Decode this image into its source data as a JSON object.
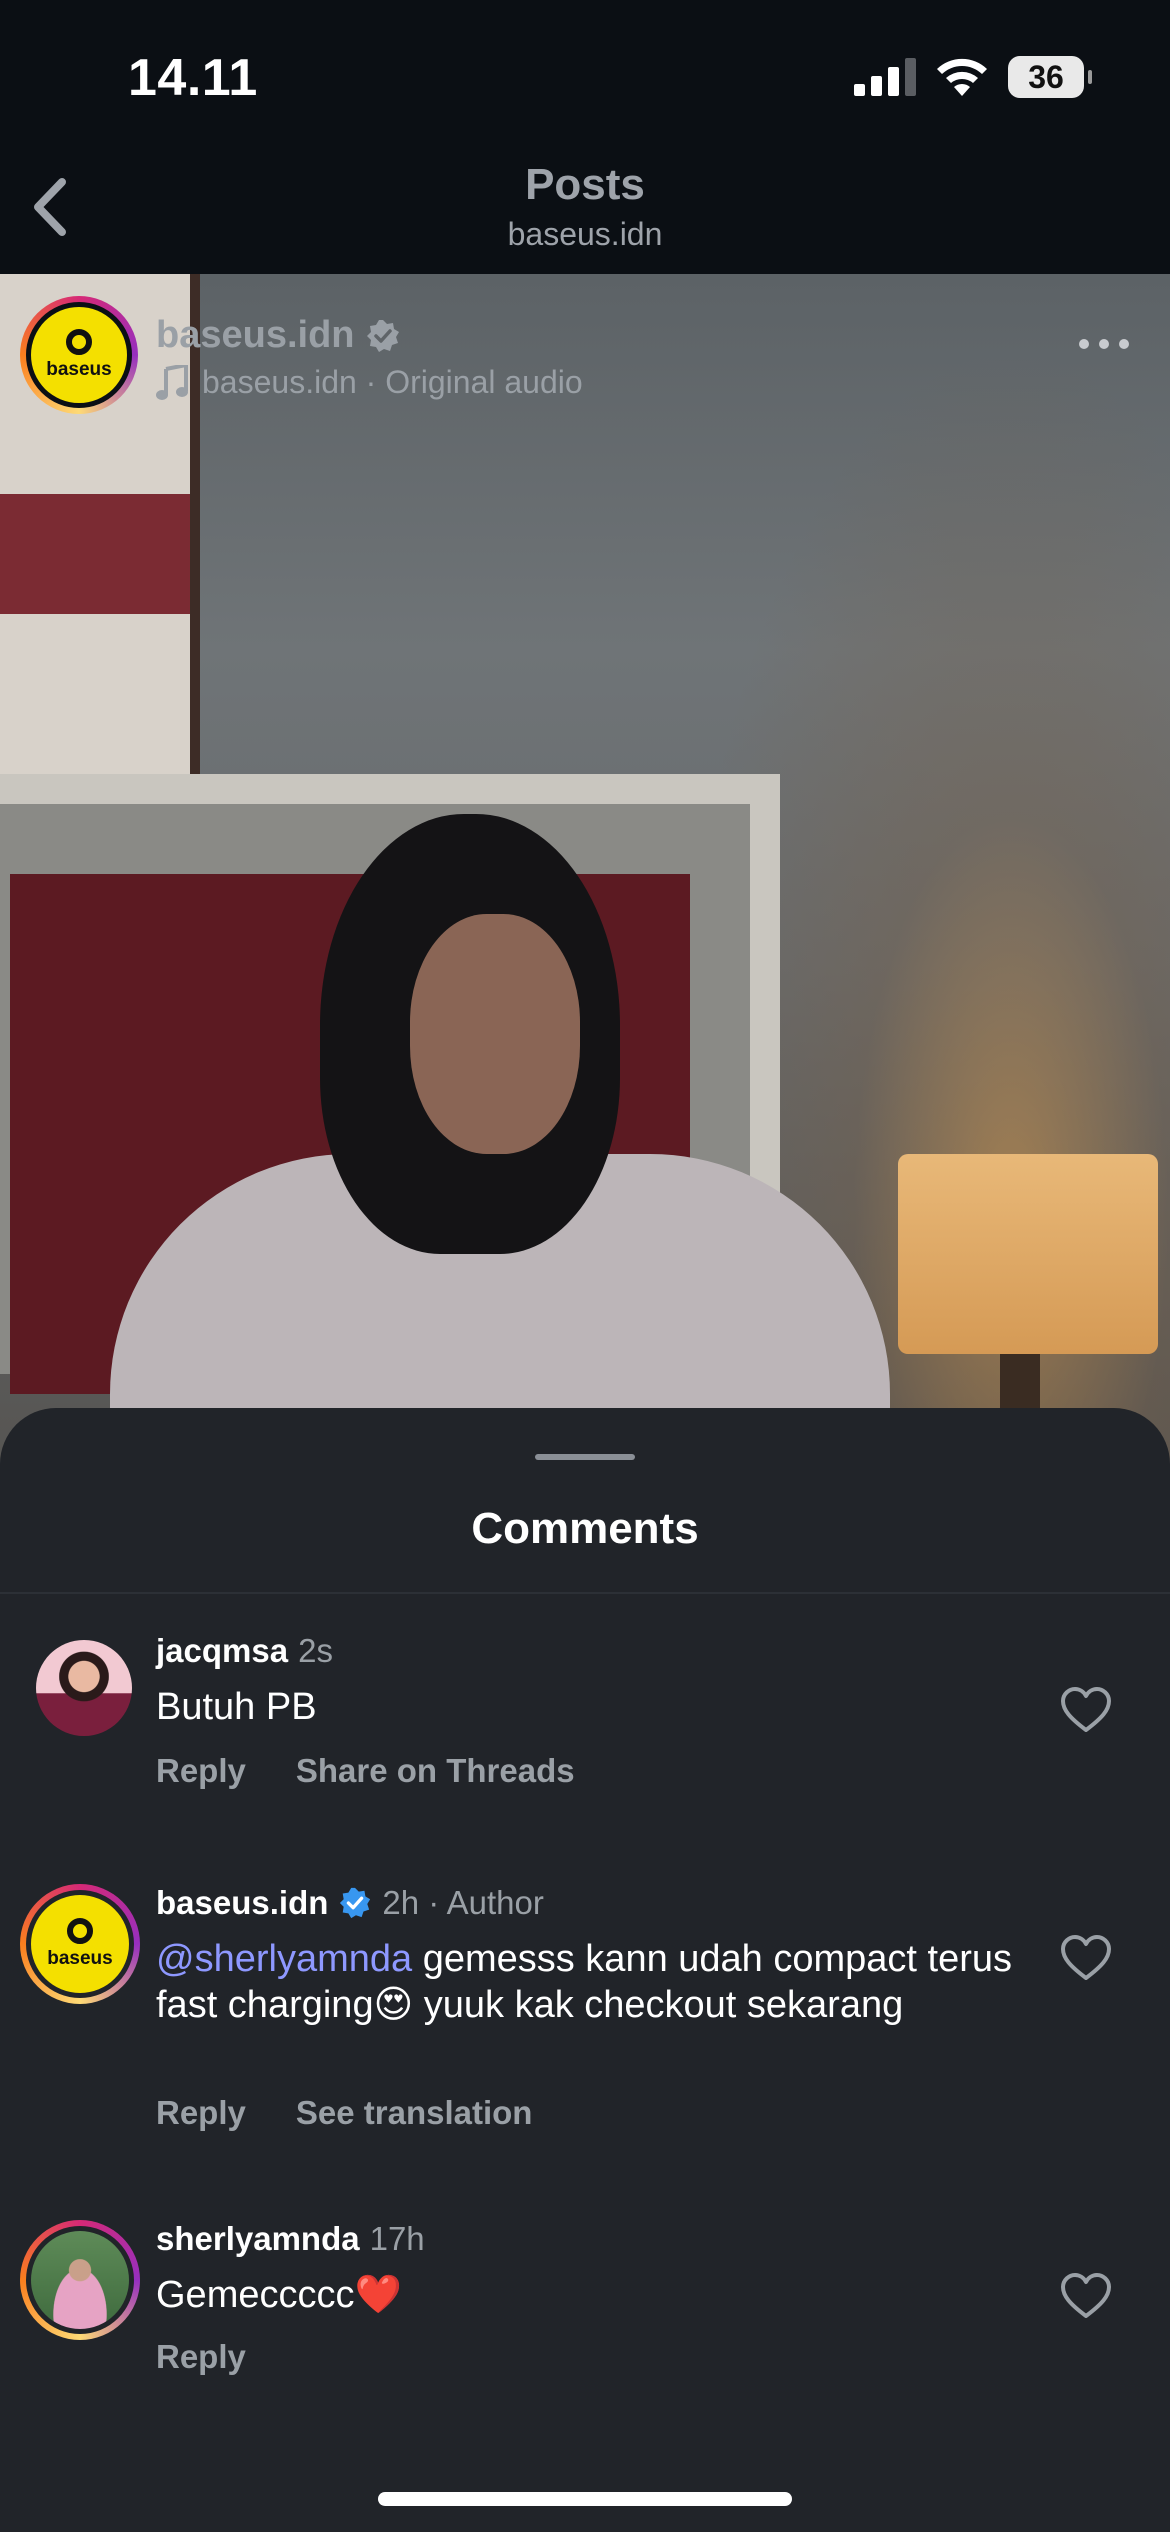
{
  "status_bar": {
    "time": "14.11",
    "battery": "36"
  },
  "nav": {
    "title": "Posts",
    "subtitle": "baseus.idn"
  },
  "post": {
    "username": "baseus.idn",
    "audio": "baseus.idn · Original audio",
    "avatar_text": "baseus"
  },
  "comments_sheet": {
    "title": "Comments",
    "comments": [
      {
        "username": "jacqmsa",
        "time": "2s",
        "text": "Butuh PB",
        "actions": [
          "Reply",
          "Share on Threads"
        ]
      },
      {
        "username": "baseus.idn",
        "time": "2h · Author",
        "mention": "@sherlyamnda",
        "text": " gemesss kann udah compact terus fast charging😍 yuuk kak checkout sekarang",
        "avatar_text": "baseus",
        "actions": [
          "Reply",
          "See translation"
        ]
      },
      {
        "username": "sherlyamnda",
        "time": "17h",
        "text": "Gemeccccc❤️",
        "actions": [
          "Reply"
        ]
      }
    ]
  },
  "colors": {
    "sheet_bg": "#212429",
    "mention": "#8e98ff",
    "verified": "#3897f0"
  },
  "icons": [
    "back-icon",
    "signal-icon",
    "wifi-icon",
    "verified-icon",
    "music-note-icon",
    "more-icon",
    "heart-icon"
  ]
}
